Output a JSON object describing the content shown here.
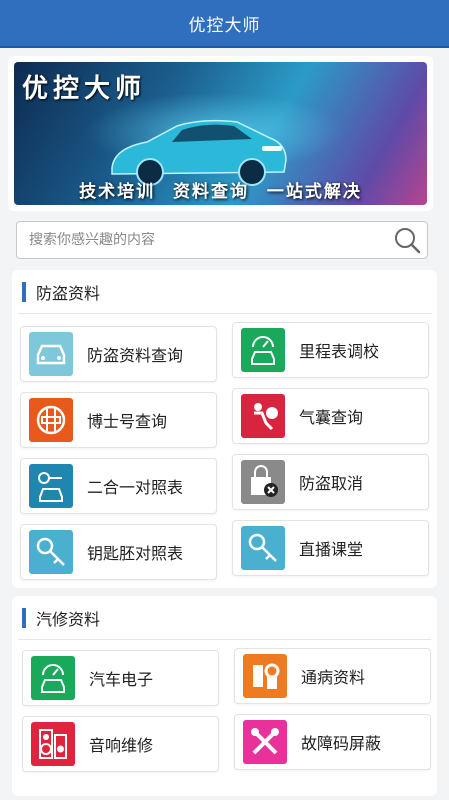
{
  "header": {
    "title": "优控大师"
  },
  "banner": {
    "title": "优控大师",
    "tagline": "技术培训  资料查询  一站式解决"
  },
  "search": {
    "placeholder": "搜索你感兴趣的内容"
  },
  "sections": [
    {
      "title": "防盗资料",
      "items": [
        {
          "label": "防盗资料查询",
          "icon": "car-front-icon",
          "color": "#7fc8dc"
        },
        {
          "label": "里程表调校",
          "icon": "odometer-car-icon",
          "color": "#1aa85a"
        },
        {
          "label": "博士号查询",
          "icon": "bosch-logo-icon",
          "color": "#e85a1c"
        },
        {
          "label": "气囊查询",
          "icon": "airbag-icon",
          "color": "#d9243f"
        },
        {
          "label": "二合一对照表",
          "icon": "key-car-icon",
          "color": "#1f86b0"
        },
        {
          "label": "防盗取消",
          "icon": "lock-cancel-icon",
          "color": "#8a8a8a"
        },
        {
          "label": "钥匙胚对照表",
          "icon": "key-icon",
          "color": "#4bb0cf"
        },
        {
          "label": "直播课堂",
          "icon": "key-icon",
          "color": "#4bb0cf"
        }
      ]
    },
    {
      "title": "汽修资料",
      "items": [
        {
          "label": "汽车电子",
          "icon": "car-electronics-icon",
          "color": "#1aa85a"
        },
        {
          "label": "通病资料",
          "icon": "wrench-gear-icon",
          "color": "#f07a20"
        },
        {
          "label": "音响维修",
          "icon": "speaker-icon",
          "color": "#e0243e"
        },
        {
          "label": "故障码屏蔽",
          "icon": "tools-icon",
          "color": "#e8319a"
        }
      ]
    }
  ]
}
